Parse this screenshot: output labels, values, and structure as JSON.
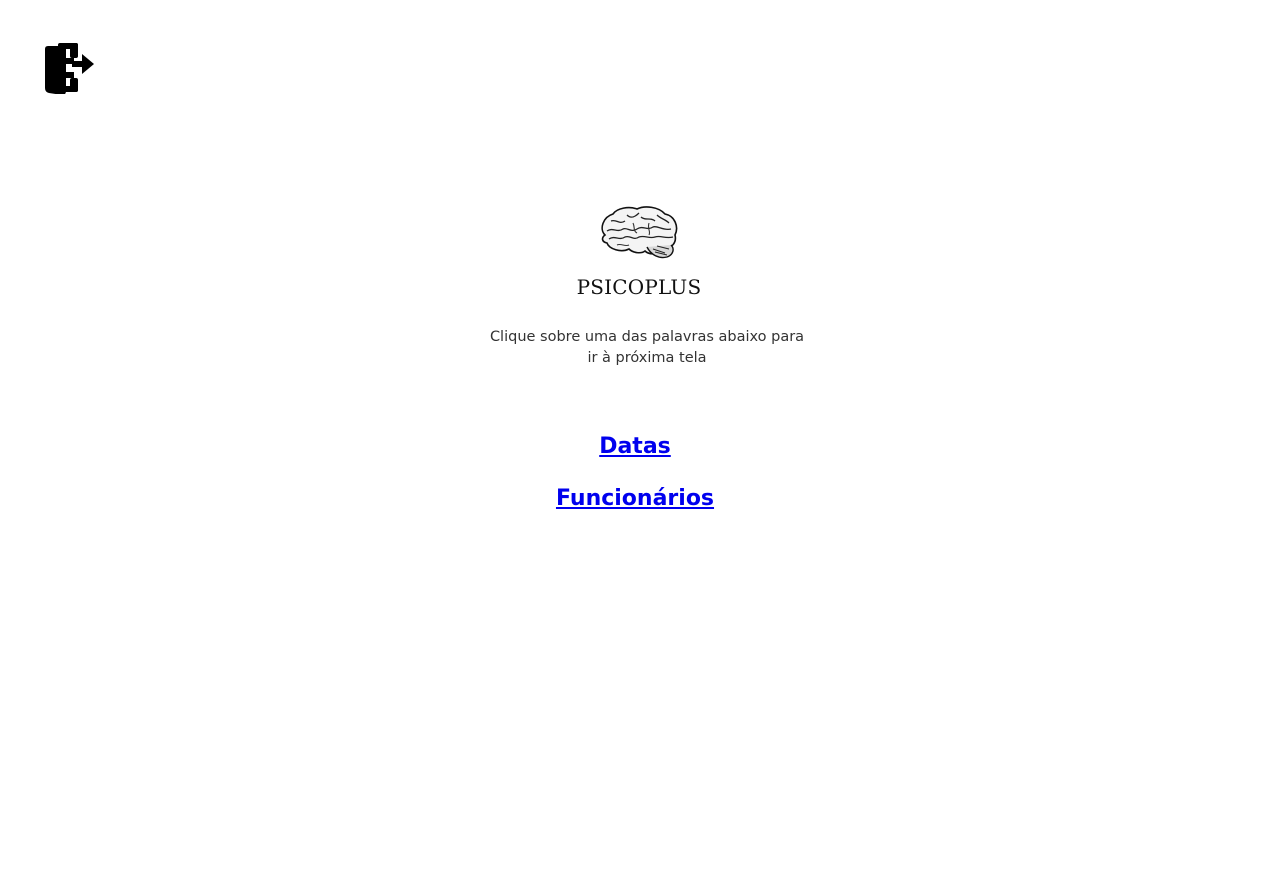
{
  "header": {
    "logout_icon": "logout-door-icon"
  },
  "brand": {
    "logo_icon": "brain-icon",
    "title": "PSICOPLUS"
  },
  "instructions": {
    "text": "Clique sobre uma das palavras abaixo para ir à próxima tela"
  },
  "links": [
    {
      "label": "Datas"
    },
    {
      "label": "Funcionários"
    }
  ],
  "colors": {
    "link": "#0000ee",
    "text": "#333333",
    "background": "#ffffff"
  }
}
